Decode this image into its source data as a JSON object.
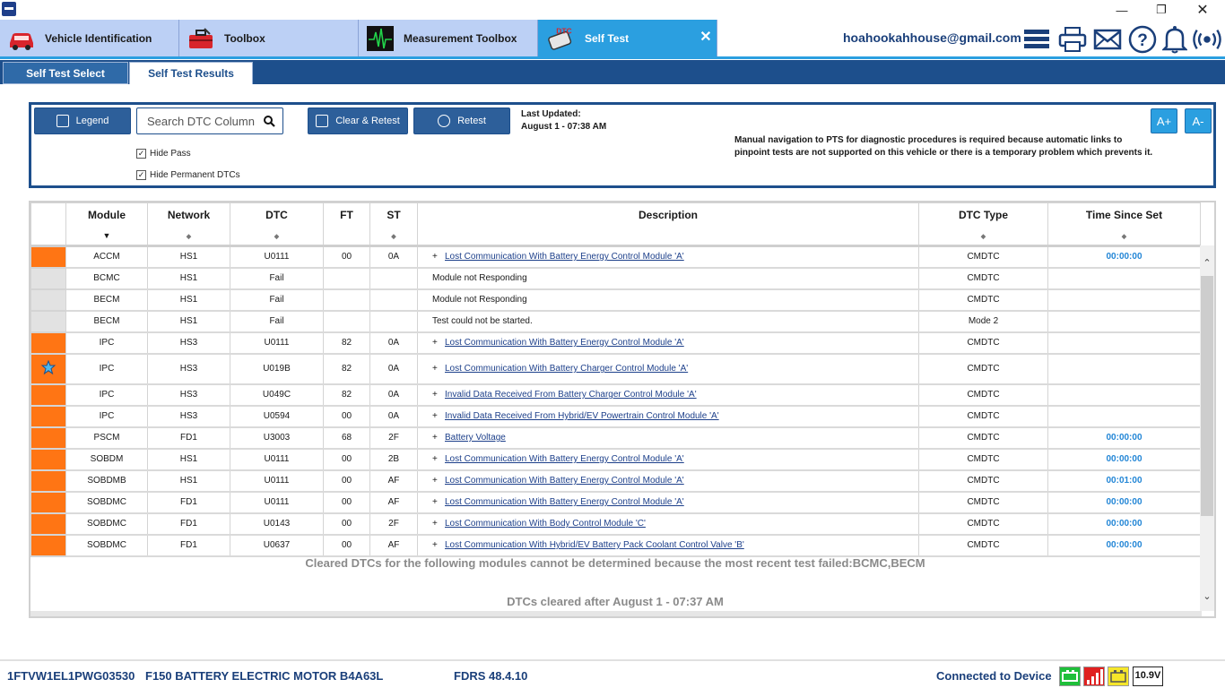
{
  "main_tabs": [
    {
      "label": "Vehicle Identification"
    },
    {
      "label": "Toolbox"
    },
    {
      "label": "Measurement Toolbox"
    },
    {
      "label": "Self Test",
      "icon_text": "DTC"
    }
  ],
  "header": {
    "email": "hoahookahhouse@gmail.com",
    "icons": [
      "menu-icon",
      "printer-icon",
      "mail-icon",
      "help-icon",
      "bell-icon",
      "signal-icon"
    ]
  },
  "sub_tabs": [
    {
      "label": "Self Test Select"
    },
    {
      "label": "Self Test Results"
    }
  ],
  "controls": {
    "legend_label": "Legend",
    "search_placeholder": "Search DTC Column",
    "clear_retest_label": "Clear & Retest",
    "retest_label": "Retest",
    "last_updated_label": "Last Updated:",
    "last_updated_value": "August 1 - 07:38 AM",
    "hide_pass_label": "Hide Pass",
    "hide_permanent_label": "Hide Permanent DTCs",
    "notice_line1": "Manual navigation to PTS for diagnostic procedures is required because automatic links to",
    "notice_line2": "pinpoint tests are not supported on this vehicle or there is a temporary problem which prevents it.",
    "font_increase": "A+",
    "font_decrease": "A-"
  },
  "table": {
    "columns": [
      "Module",
      "Network",
      "DTC",
      "FT",
      "ST",
      "Description",
      "DTC Type",
      "Time Since Set"
    ],
    "rows": [
      {
        "status": "fail",
        "module": "ACCM",
        "network": "HS1",
        "dtc": "U0111",
        "ft": "00",
        "st": "0A",
        "plus": "+",
        "description": "Lost Communication With Battery Energy Control Module 'A'",
        "dtc_type": "CMDTC",
        "time": "00:00:00",
        "starred": false
      },
      {
        "status": "info",
        "module": "BCMC",
        "network": "HS1",
        "dtc": "Fail",
        "ft": "",
        "st": "",
        "plus": "",
        "description": "Module not Responding",
        "dtc_type": "CMDTC",
        "time": "",
        "starred": false
      },
      {
        "status": "info",
        "module": "BECM",
        "network": "HS1",
        "dtc": "Fail",
        "ft": "",
        "st": "",
        "plus": "",
        "description": "Module not Responding",
        "dtc_type": "CMDTC",
        "time": "",
        "starred": false
      },
      {
        "status": "info",
        "module": "BECM",
        "network": "HS1",
        "dtc": "Fail",
        "ft": "",
        "st": "",
        "plus": "",
        "description": "Test could not be started.",
        "dtc_type": "Mode 2",
        "time": "",
        "starred": false
      },
      {
        "status": "fail",
        "module": "IPC",
        "network": "HS3",
        "dtc": "U0111",
        "ft": "82",
        "st": "0A",
        "plus": "+",
        "description": "Lost Communication With Battery Energy Control Module 'A'",
        "dtc_type": "CMDTC",
        "time": "",
        "starred": false
      },
      {
        "status": "fail",
        "module": "IPC",
        "network": "HS3",
        "dtc": "U019B",
        "ft": "82",
        "st": "0A",
        "plus": "+",
        "description": "Lost Communication With Battery Charger Control Module 'A'",
        "dtc_type": "CMDTC",
        "time": "",
        "starred": true
      },
      {
        "status": "fail",
        "module": "IPC",
        "network": "HS3",
        "dtc": "U049C",
        "ft": "82",
        "st": "0A",
        "plus": "+",
        "description": "Invalid Data Received From Battery Charger Control Module 'A'",
        "dtc_type": "CMDTC",
        "time": "",
        "starred": false
      },
      {
        "status": "fail",
        "module": "IPC",
        "network": "HS3",
        "dtc": "U0594",
        "ft": "00",
        "st": "0A",
        "plus": "+",
        "description": "Invalid Data Received From Hybrid/EV Powertrain Control Module 'A'",
        "dtc_type": "CMDTC",
        "time": "",
        "starred": false
      },
      {
        "status": "fail",
        "module": "PSCM",
        "network": "FD1",
        "dtc": "U3003",
        "ft": "68",
        "st": "2F",
        "plus": "+",
        "description": "Battery Voltage",
        "dtc_type": "CMDTC",
        "time": "00:00:00",
        "starred": false
      },
      {
        "status": "fail",
        "module": "SOBDM",
        "network": "HS1",
        "dtc": "U0111",
        "ft": "00",
        "st": "2B",
        "plus": "+",
        "description": "Lost Communication With Battery Energy Control Module 'A'",
        "dtc_type": "CMDTC",
        "time": "00:00:00",
        "starred": false
      },
      {
        "status": "fail",
        "module": "SOBDMB",
        "network": "HS1",
        "dtc": "U0111",
        "ft": "00",
        "st": "AF",
        "plus": "+",
        "description": "Lost Communication With Battery Energy Control Module 'A'",
        "dtc_type": "CMDTC",
        "time": "00:01:00",
        "starred": false
      },
      {
        "status": "fail",
        "module": "SOBDMC",
        "network": "FD1",
        "dtc": "U0111",
        "ft": "00",
        "st": "AF",
        "plus": "+",
        "description": "Lost Communication With Battery Energy Control Module 'A'",
        "dtc_type": "CMDTC",
        "time": "00:00:00",
        "starred": false
      },
      {
        "status": "fail",
        "module": "SOBDMC",
        "network": "FD1",
        "dtc": "U0143",
        "ft": "00",
        "st": "2F",
        "plus": "+",
        "description": "Lost Communication With Body Control Module 'C'",
        "dtc_type": "CMDTC",
        "time": "00:00:00",
        "starred": false
      },
      {
        "status": "fail",
        "module": "SOBDMC",
        "network": "FD1",
        "dtc": "U0637",
        "ft": "00",
        "st": "AF",
        "plus": "+",
        "description": "Lost Communication With Hybrid/EV Battery Pack Coolant Control Valve 'B'",
        "dtc_type": "CMDTC",
        "time": "00:00:00",
        "starred": false
      }
    ],
    "cleared_message": "Cleared DTCs for the following modules cannot be determined because the most recent test failed:BCMC,BECM",
    "cleared_after": "DTCs cleared after  August 1 - 07:37 AM"
  },
  "footer": {
    "vin": "1FTVW1EL1PWG03530",
    "vehicle": "F150 BATTERY ELECTRIC MOTOR B4A63L",
    "version": "FDRS 48.4.10",
    "connection": "Connected to Device",
    "voltage": "10.9V"
  },
  "colors": {
    "fail_status": "#ff7514",
    "info_status": "#e2e2e2",
    "active_tab": "#2b9fe0",
    "inactive_tab": "#bcd0f5",
    "subtab_bar": "#1d4f8c",
    "link": "#1c3f8a",
    "time": "#2386d6"
  }
}
